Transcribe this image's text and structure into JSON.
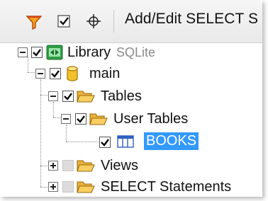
{
  "toolbar": {
    "title": "Add/Edit SELECT S",
    "buttons": [
      {
        "icon": "filter-icon"
      },
      {
        "icon": "checkbox-check-icon"
      },
      {
        "icon": "locate-crosshair-icon"
      }
    ]
  },
  "tree": {
    "library": {
      "label": "Library",
      "sublabel": "SQLite",
      "checked": true,
      "expanded": true,
      "icon": "library-database-icon"
    },
    "main": {
      "label": "main",
      "checked": true,
      "expanded": true,
      "icon": "database-cylinder-icon"
    },
    "tables": {
      "label": "Tables",
      "checked": true,
      "expanded": true,
      "icon": "folder-open-icon"
    },
    "user_tables": {
      "label": "User Tables",
      "checked": true,
      "expanded": true,
      "icon": "folder-open-icon"
    },
    "books": {
      "label": "BOOKS",
      "checked": true,
      "selected": true,
      "icon": "table-icon"
    },
    "views": {
      "label": "Views",
      "checked": false,
      "expanded": false,
      "icon": "folder-open-icon"
    },
    "select_statements": {
      "label": "SELECT Statements",
      "checked": false,
      "expanded": false,
      "icon": "folder-open-icon"
    }
  },
  "colors": {
    "selection": "#3399ff",
    "folder": "#f3c04b",
    "db_cylinder": "#f2c12e",
    "library_icon": "#2e9e43"
  }
}
